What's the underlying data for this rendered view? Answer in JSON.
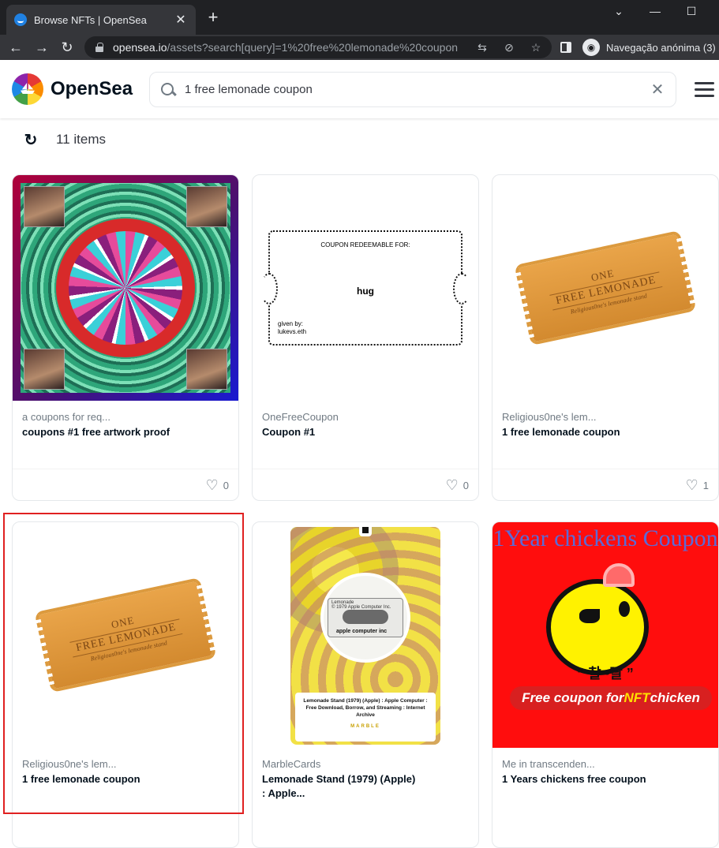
{
  "browser": {
    "tab_title": "Browse NFTs | OpenSea",
    "new_tab": "+",
    "url_host": "opensea.io",
    "url_path": "/assets?search[query]=1%20free%20lemonade%20coupon",
    "incognito_label": "Navegação anónima (3)",
    "icons": [
      "translate-icon",
      "tracking-off-icon",
      "bookmark-star-icon",
      "side-panel-icon",
      "incognito-icon"
    ]
  },
  "header": {
    "brand": "OpenSea",
    "search_value": "1 free lemonade coupon"
  },
  "results": {
    "count_label": "11 items"
  },
  "cards": [
    {
      "collection": "a coupons for req...",
      "name": "coupons #1 free artwork proof",
      "likes": "0"
    },
    {
      "collection": "OneFreeCoupon",
      "name": "Coupon #1",
      "likes": "0",
      "art": {
        "title": "COUPON REDEEMABLE FOR:",
        "main": "hug",
        "by_label": "given by:",
        "by_name": "lukevs.eth"
      }
    },
    {
      "collection": "Religious0ne's lem...",
      "name": "1 free lemonade coupon",
      "likes": "1",
      "art": {
        "line1": "ONE",
        "line2": "FREE LEMONADE",
        "line3": "Religious0ne's lemonade stand"
      }
    },
    {
      "collection": "Religious0ne's lem...",
      "name": "1 free lemonade coupon",
      "art": {
        "line1": "ONE",
        "line2": "FREE LEMONADE",
        "line3": "Religious0ne's lemonade stand"
      }
    },
    {
      "collection": "MarbleCards",
      "name": "Lemonade Stand (1979) (Apple) : Apple...",
      "art": {
        "cassette_label": "Lemonade",
        "cassette_sub": "© 1979 Apple Computer Inc.",
        "cassette_brand": "apple computer inc",
        "caption": "Lemonade Stand (1979) (Apple) : Apple Computer : Free Download, Borrow, and Streaming : Internet Archive",
        "marble": "MARBLE"
      }
    },
    {
      "collection": "Me in transcenden...",
      "name": "1 Years chickens free coupon",
      "art": {
        "title": "1Year chickens Coupon",
        "korean": "“ 찰~딸 ”",
        "banner_pre": "Free coupon for ",
        "banner_nft": "NFT",
        "banner_post": " chicken"
      }
    }
  ]
}
